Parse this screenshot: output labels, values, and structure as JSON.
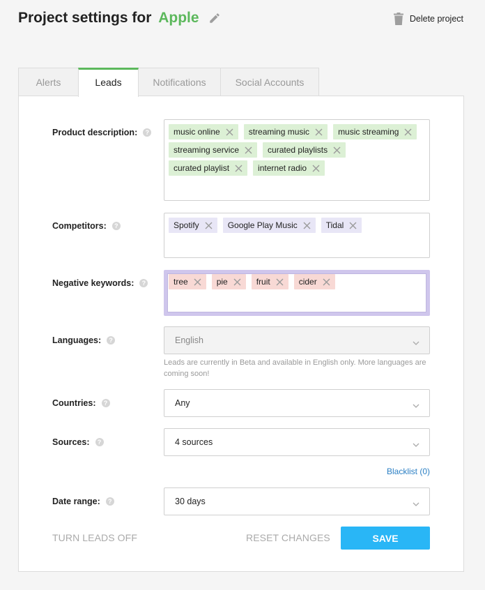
{
  "header": {
    "title_prefix": "Project settings for",
    "project_name": "Apple",
    "delete_label": "Delete project"
  },
  "tabs": [
    {
      "label": "Alerts"
    },
    {
      "label": "Leads"
    },
    {
      "label": "Notifications"
    },
    {
      "label": "Social Accounts"
    }
  ],
  "active_tab": "Leads",
  "form": {
    "product_description": {
      "label": "Product description:",
      "tags": [
        "music online",
        "streaming music",
        "music streaming",
        "streaming service",
        "curated playlists",
        "curated playlist",
        "internet radio"
      ]
    },
    "competitors": {
      "label": "Competitors:",
      "tags": [
        "Spotify",
        "Google Play Music",
        "Tidal"
      ]
    },
    "negative_keywords": {
      "label": "Negative keywords:",
      "tags": [
        "tree",
        "pie",
        "fruit",
        "cider"
      ]
    },
    "languages": {
      "label": "Languages:",
      "value": "English",
      "note": "Leads are currently in Beta and available in English only. More languages are coming soon!"
    },
    "countries": {
      "label": "Countries:",
      "value": "Any"
    },
    "sources": {
      "label": "Sources:",
      "value": "4 sources"
    },
    "blacklist_label": "Blacklist (0)",
    "date_range": {
      "label": "Date range:",
      "value": "30 days"
    }
  },
  "footer": {
    "turn_off_label": "TURN LEADS OFF",
    "reset_label": "RESET CHANGES",
    "save_label": "SAVE"
  },
  "colors": {
    "brand": "#5cb85c",
    "save_button": "#29b6f6",
    "link": "#2a7fc4",
    "tag_product": "#dcf0d5",
    "tag_competitor": "#e8e6f6",
    "tag_negative": "#f8d9d5"
  }
}
